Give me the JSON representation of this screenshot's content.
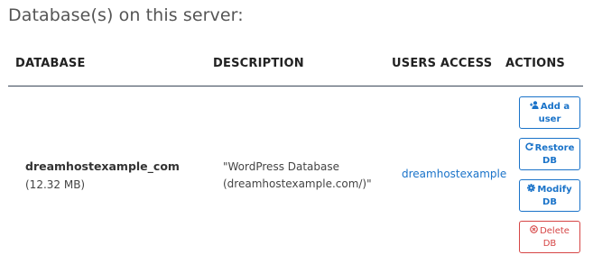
{
  "page": {
    "title": "Database(s) on this server:"
  },
  "table": {
    "headers": {
      "database": "DATABASE",
      "description": "DESCRIPTION",
      "users_access": "USERS ACCESS",
      "actions": "ACTIONS"
    },
    "rows": [
      {
        "name": "dreamhostexample_com",
        "size": "(12.32 MB)",
        "description_line1": "\"WordPress Database",
        "description_line2": "(dreamhostexample.com/)\"",
        "user": "dreamhostexample",
        "actions": {
          "add_user": {
            "line1": "Add a",
            "line2": "user",
            "icon": "add-user-icon"
          },
          "restore": {
            "line1": "Restore",
            "line2": "DB",
            "icon": "refresh-icon"
          },
          "modify": {
            "line1": "Modify",
            "line2": "DB",
            "icon": "gear-icon"
          },
          "delete": {
            "line1": "Delete",
            "line2": "DB",
            "icon": "close-circle-icon"
          }
        }
      }
    ]
  },
  "colors": {
    "link": "#1a73c9",
    "danger": "#d64545",
    "divider": "#3a4758"
  }
}
